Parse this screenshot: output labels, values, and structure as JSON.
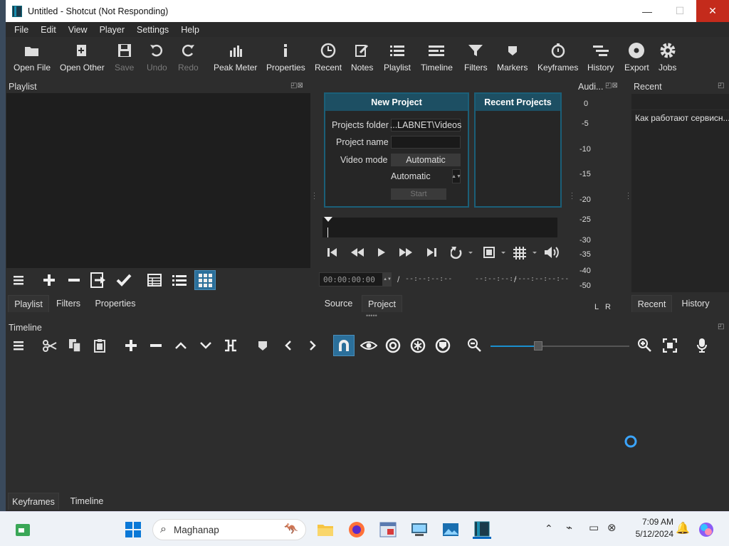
{
  "window": {
    "title": "Untitled - Shotcut (Not Responding)",
    "controls": {
      "minimize": "—",
      "maximize": "☐",
      "close": "✕"
    }
  },
  "menu": [
    "File",
    "Edit",
    "View",
    "Player",
    "Settings",
    "Help"
  ],
  "toolbar": [
    {
      "label": "Open File",
      "icon": "folder-open-icon",
      "enabled": true
    },
    {
      "label": "Open Other",
      "icon": "open-other-icon",
      "enabled": true
    },
    {
      "label": "Save",
      "icon": "save-icon",
      "enabled": false
    },
    {
      "label": "Undo",
      "icon": "undo-icon",
      "enabled": false
    },
    {
      "label": "Redo",
      "icon": "redo-icon",
      "enabled": false
    },
    {
      "label": "Peak Meter",
      "icon": "peak-meter-icon",
      "enabled": true
    },
    {
      "label": "Properties",
      "icon": "info-icon",
      "enabled": true
    },
    {
      "label": "Recent",
      "icon": "clock-icon",
      "enabled": true
    },
    {
      "label": "Notes",
      "icon": "notes-icon",
      "enabled": true
    },
    {
      "label": "Playlist",
      "icon": "list-icon",
      "enabled": true
    },
    {
      "label": "Timeline",
      "icon": "timeline-icon",
      "enabled": true
    },
    {
      "label": "Filters",
      "icon": "filter-icon",
      "enabled": true
    },
    {
      "label": "Markers",
      "icon": "marker-icon",
      "enabled": true
    },
    {
      "label": "Keyframes",
      "icon": "stopwatch-icon",
      "enabled": true
    },
    {
      "label": "History",
      "icon": "history-icon",
      "enabled": true
    },
    {
      "label": "Export",
      "icon": "export-icon",
      "enabled": true
    },
    {
      "label": "Jobs",
      "icon": "gear-icon",
      "enabled": true
    }
  ],
  "playlist": {
    "title": "Playlist",
    "tabs": [
      "Playlist",
      "Filters",
      "Properties"
    ]
  },
  "new_project": {
    "title": "New Project",
    "projects_folder_label": "Projects folder",
    "projects_folder_value": "...LABNET\\Videos",
    "project_name_label": "Project name",
    "project_name_value": "",
    "video_mode_label": "Video mode",
    "video_mode_value": "Automatic",
    "mode_spinner_value": "Automatic",
    "start_label": "Start"
  },
  "recent_projects": {
    "title": "Recent Projects"
  },
  "player": {
    "timecode": "00:00:00:00",
    "separator": "/",
    "duration": "--:--:--:--",
    "in_point": "--:--:--:--",
    "out_point": "--:--:--:--",
    "tabs": [
      "Source",
      "Project"
    ]
  },
  "audio": {
    "title": "Audi...",
    "scale": [
      "0",
      "-5",
      "-10",
      "-15",
      "-20",
      "-25",
      "-30",
      "-35",
      "-40",
      "-50"
    ],
    "channels": [
      "L",
      "R"
    ]
  },
  "recent": {
    "title": "Recent",
    "item": "Как работают сервисн...",
    "tabs": [
      "Recent",
      "History"
    ]
  },
  "timeline": {
    "title": "Timeline",
    "tabs": [
      "Keyframes",
      "Timeline"
    ]
  },
  "taskbar": {
    "search_placeholder": "Maghanap",
    "time": "7:09 AM",
    "date": "5/12/2024",
    "colors": {
      "accent": "#0067c0",
      "app_bg": "#2d2d2d"
    }
  }
}
